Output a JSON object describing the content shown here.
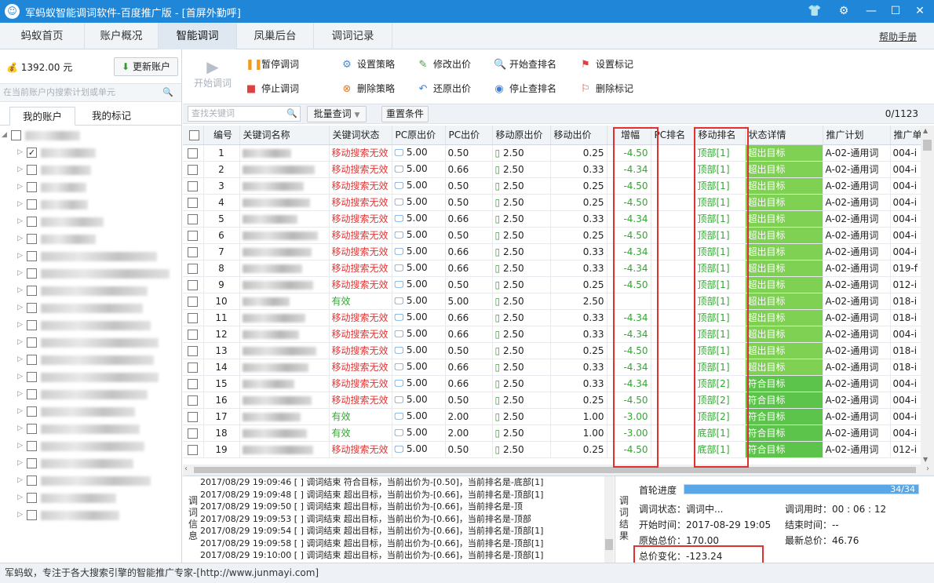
{
  "app": {
    "title": "军蚂蚁智能调词软件-百度推广版 - [首屏外勤呼]"
  },
  "tabs": [
    {
      "label": "蚂蚁首页"
    },
    {
      "label": "账户概况"
    },
    {
      "label": "智能调词"
    },
    {
      "label": "凤巢后台"
    },
    {
      "label": "调词记录"
    }
  ],
  "help_label": "帮助手册",
  "left": {
    "balance": "1392.00 元",
    "update_btn": "更新账户",
    "search_placeholder": "在当前账户内搜索计划或单元",
    "tab_account": "我的账户",
    "tab_marks": "我的标记"
  },
  "toolbar": {
    "start": "开始调词",
    "pause": "暂停调词",
    "stop": "停止调词",
    "set_strategy": "设置策略",
    "del_strategy": "删除策略",
    "edit_bid": "修改出价",
    "restore_bid": "还原出价",
    "start_rank": "开始查排名",
    "stop_rank": "停止查排名",
    "set_mark": "设置标记",
    "del_mark": "删除标记"
  },
  "filter": {
    "search_placeholder": "查找关键词",
    "batch": "批量查词",
    "reset": "重置条件",
    "count": "0/1123"
  },
  "columns": [
    "编号",
    "关键词名称",
    "关键词状态",
    "PC原出价",
    "PC出价",
    "移动原出价",
    "移动出价",
    "增幅",
    "PC排名",
    "移动排名",
    "状态详情",
    "推广计划",
    "推广单"
  ],
  "rows": [
    {
      "n": "1",
      "st": "移动搜索无效",
      "pco": "5.00",
      "pc": "0.50",
      "mo": "2.50",
      "m": "0.25",
      "inc": "-4.50",
      "rank": "顶部[1]",
      "det": "超出目标",
      "plan": "A-02-通用词",
      "unit": "004-i"
    },
    {
      "n": "2",
      "st": "移动搜索无效",
      "pco": "5.00",
      "pc": "0.66",
      "mo": "2.50",
      "m": "0.33",
      "inc": "-4.34",
      "rank": "顶部[1]",
      "det": "超出目标",
      "plan": "A-02-通用词",
      "unit": "004-i"
    },
    {
      "n": "3",
      "st": "移动搜索无效",
      "pco": "5.00",
      "pc": "0.50",
      "mo": "2.50",
      "m": "0.25",
      "inc": "-4.50",
      "rank": "顶部[1]",
      "det": "超出目标",
      "plan": "A-02-通用词",
      "unit": "004-i"
    },
    {
      "n": "4",
      "st": "移动搜索无效",
      "pco": "5.00",
      "pc": "0.50",
      "mo": "2.50",
      "m": "0.25",
      "inc": "-4.50",
      "rank": "顶部[1]",
      "det": "超出目标",
      "plan": "A-02-通用词",
      "unit": "004-i"
    },
    {
      "n": "5",
      "st": "移动搜索无效",
      "pco": "5.00",
      "pc": "0.66",
      "mo": "2.50",
      "m": "0.33",
      "inc": "-4.34",
      "rank": "顶部[1]",
      "det": "超出目标",
      "plan": "A-02-通用词",
      "unit": "004-i"
    },
    {
      "n": "6",
      "st": "移动搜索无效",
      "pco": "5.00",
      "pc": "0.50",
      "mo": "2.50",
      "m": "0.25",
      "inc": "-4.50",
      "rank": "顶部[1]",
      "det": "超出目标",
      "plan": "A-02-通用词",
      "unit": "004-i"
    },
    {
      "n": "7",
      "st": "移动搜索无效",
      "pco": "5.00",
      "pc": "0.66",
      "mo": "2.50",
      "m": "0.33",
      "inc": "-4.34",
      "rank": "顶部[1]",
      "det": "超出目标",
      "plan": "A-02-通用词",
      "unit": "004-i"
    },
    {
      "n": "8",
      "st": "移动搜索无效",
      "pco": "5.00",
      "pc": "0.66",
      "mo": "2.50",
      "m": "0.33",
      "inc": "-4.34",
      "rank": "顶部[1]",
      "det": "超出目标",
      "plan": "A-02-通用词",
      "unit": "019-f"
    },
    {
      "n": "9",
      "st": "移动搜索无效",
      "pco": "5.00",
      "pc": "0.50",
      "mo": "2.50",
      "m": "0.25",
      "inc": "-4.50",
      "rank": "顶部[1]",
      "det": "超出目标",
      "plan": "A-02-通用词",
      "unit": "012-i"
    },
    {
      "n": "10",
      "st": "有效",
      "pco": "5.00",
      "pc": "5.00",
      "mo": "2.50",
      "m": "2.50",
      "inc": "",
      "rank": "顶部[1]",
      "det": "超出目标",
      "plan": "A-02-通用词",
      "unit": "018-i"
    },
    {
      "n": "11",
      "st": "移动搜索无效",
      "pco": "5.00",
      "pc": "0.66",
      "mo": "2.50",
      "m": "0.33",
      "inc": "-4.34",
      "rank": "顶部[1]",
      "det": "超出目标",
      "plan": "A-02-通用词",
      "unit": "018-i"
    },
    {
      "n": "12",
      "st": "移动搜索无效",
      "pco": "5.00",
      "pc": "0.66",
      "mo": "2.50",
      "m": "0.33",
      "inc": "-4.34",
      "rank": "顶部[1]",
      "det": "超出目标",
      "plan": "A-02-通用词",
      "unit": "004-i"
    },
    {
      "n": "13",
      "st": "移动搜索无效",
      "pco": "5.00",
      "pc": "0.50",
      "mo": "2.50",
      "m": "0.25",
      "inc": "-4.50",
      "rank": "顶部[1]",
      "det": "超出目标",
      "plan": "A-02-通用词",
      "unit": "018-i"
    },
    {
      "n": "14",
      "st": "移动搜索无效",
      "pco": "5.00",
      "pc": "0.66",
      "mo": "2.50",
      "m": "0.33",
      "inc": "-4.34",
      "rank": "顶部[1]",
      "det": "超出目标",
      "plan": "A-02-通用词",
      "unit": "018-i"
    },
    {
      "n": "15",
      "st": "移动搜索无效",
      "pco": "5.00",
      "pc": "0.66",
      "mo": "2.50",
      "m": "0.33",
      "inc": "-4.34",
      "rank": "顶部[2]",
      "det": "符合目标",
      "plan": "A-02-通用词",
      "unit": "004-i"
    },
    {
      "n": "16",
      "st": "移动搜索无效",
      "pco": "5.00",
      "pc": "0.50",
      "mo": "2.50",
      "m": "0.25",
      "inc": "-4.50",
      "rank": "顶部[2]",
      "det": "符合目标",
      "plan": "A-02-通用词",
      "unit": "004-i"
    },
    {
      "n": "17",
      "st": "有效",
      "pco": "5.00",
      "pc": "2.00",
      "mo": "2.50",
      "m": "1.00",
      "inc": "-3.00",
      "rank": "顶部[2]",
      "det": "符合目标",
      "plan": "A-02-通用词",
      "unit": "004-i"
    },
    {
      "n": "18",
      "st": "有效",
      "pco": "5.00",
      "pc": "2.00",
      "mo": "2.50",
      "m": "1.00",
      "inc": "-3.00",
      "rank": "底部[1]",
      "det": "符合目标",
      "plan": "A-02-通用词",
      "unit": "004-i"
    },
    {
      "n": "19",
      "st": "移动搜索无效",
      "pco": "5.00",
      "pc": "0.50",
      "mo": "2.50",
      "m": "0.25",
      "inc": "-4.50",
      "rank": "底部[1]",
      "det": "符合目标",
      "plan": "A-02-通用词",
      "unit": "012-i"
    }
  ],
  "log_label": "调词信息",
  "logs": [
    "2017/08/29 19:09:46 [            ] 调词结束 符合目标，当前出价为-[0.50]，当前排名是-底部[1]",
    "2017/08/29 19:09:48 [            ] 调词结束 超出目标，当前出价为-[0.66]，当前排名是-顶部[1]",
    "2017/08/29 19:09:50 [            ] 调词结束 超出目标，当前出价为-[0.66]，当前排名是-顶",
    "2017/08/29 19:09:53 [            ] 调词结束 超出目标，当前出价为-[0.66]，当前排名是-顶部",
    "2017/08/29 19:09:54 [            ] 调词结束 超出目标，当前出价为-[0.66]，当前排名是-顶部[1]",
    "2017/08/29 19:09:58 [            ] 调词结束 超出目标，当前出价为-[0.66]，当前排名是-顶部[1]",
    "2017/08/29 19:10:00 [            ] 调词结束 超出目标，当前出价为-[0.66]，当前排名是-顶部[1]"
  ],
  "result_label": "调词结果",
  "result": {
    "progress_label": "首轮进度",
    "progress_text": "34/34",
    "progress_value": 1.0,
    "state_label": "调词状态",
    "state": "：调词中...",
    "time_label": "调词用时",
    "time": "：00 : 06 : 12",
    "start_label": "开始时间",
    "start": "：2017-08-29 19:05",
    "end_label": "结束时间",
    "end": "：--",
    "orig_label": "原始总价",
    "orig": "：170.00",
    "latest_label": "最新总价",
    "latest": "：46.76",
    "change_label": "总价变化",
    "change": "：-123.24"
  },
  "statusbar": "军蚂蚁，专注于各大搜索引擎的智能推广专家-[http://www.junmayi.com]",
  "colors": {
    "title": "#1f86d8",
    "good": "#7ed152",
    "red": "#e23434",
    "green": "#34a534",
    "highlight": "#e03030"
  }
}
